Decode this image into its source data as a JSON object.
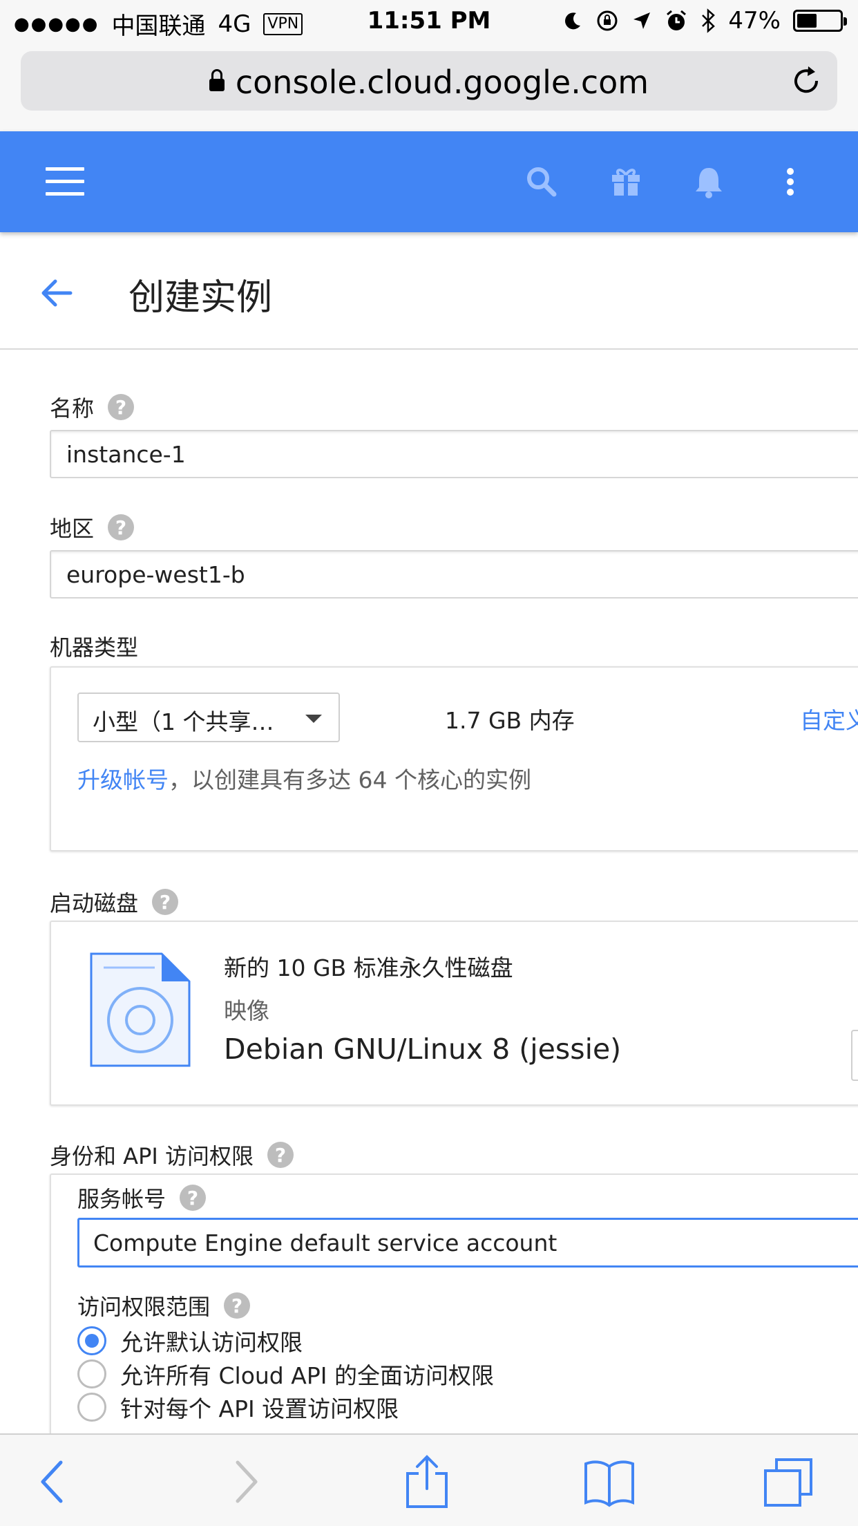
{
  "status_bar": {
    "signal_dots": "●●●●●",
    "carrier": "中国联通",
    "network": "4G",
    "vpn": "VPN",
    "time": "11:51 PM",
    "battery_text": "47%",
    "battery_level": 0.47
  },
  "browser": {
    "url": "console.cloud.google.com"
  },
  "page": {
    "title": "创建实例"
  },
  "form": {
    "name": {
      "label": "名称",
      "value": "instance-1"
    },
    "zone": {
      "label": "地区",
      "value": "europe-west1-b"
    },
    "machine_type": {
      "label": "机器类型",
      "select_value": "小型（1 个共享…",
      "memory": "1.7 GB 内存",
      "customize_link": "自定义",
      "upgrade_link": "升级帐号",
      "upgrade_text": "，以创建具有多达 64 个核心的实例"
    },
    "boot_disk": {
      "label": "启动磁盘",
      "title": "新的 10 GB 标准永久性磁盘",
      "image_label": "映像",
      "image_value": "Debian GNU/Linux 8 (jessie)"
    },
    "identity": {
      "label": "身份和 API 访问权限",
      "service_account_label": "服务帐号",
      "service_account_value": "Compute Engine default service account",
      "scopes_label": "访问权限范围",
      "scopes": [
        {
          "label": "允许默认访问权限",
          "selected": true
        },
        {
          "label": "允许所有 Cloud API 的全面访问权限",
          "selected": false
        },
        {
          "label": "针对每个 API 设置访问权限",
          "selected": false
        }
      ]
    }
  },
  "colors": {
    "accent": "#4285f4",
    "appbar": "#4285f4"
  },
  "icons": {
    "menu": "hamburger-menu-icon",
    "search": "search-icon",
    "gift": "gift-icon",
    "notifications": "bell-icon",
    "more": "more-vert-icon",
    "back": "arrow-back-icon",
    "disk": "disk-image-icon"
  }
}
